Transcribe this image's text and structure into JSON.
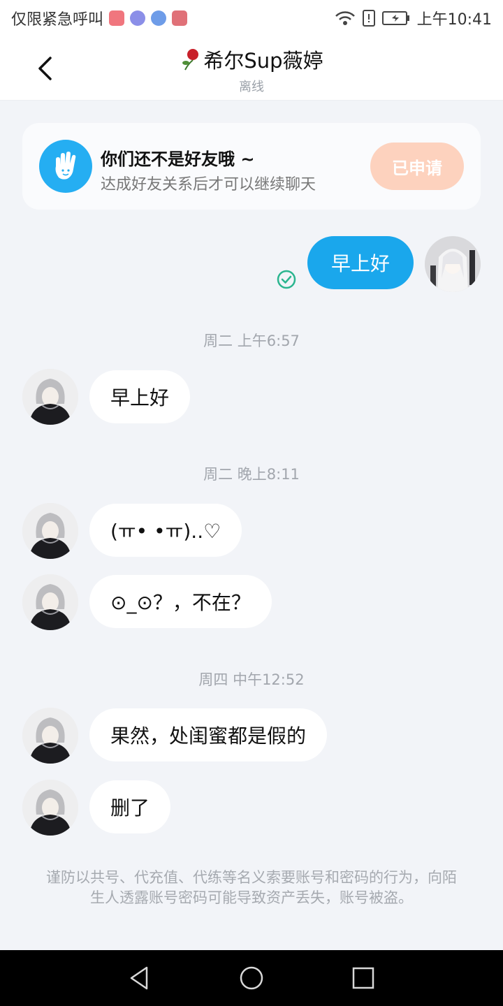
{
  "status_bar": {
    "carrier": "仅限紧急呼叫",
    "time": "上午10:41",
    "app_icon_colors": [
      "#f0767e",
      "#8b8fe8",
      "#6e9ce8",
      "#e07178"
    ]
  },
  "header": {
    "title": "希尔Sup薇婷",
    "status": "离线"
  },
  "friend_card": {
    "title": "你们还不是好友哦 ~",
    "subtitle": "达成好友关系后才可以继续聊天",
    "button": "已申请",
    "icon": "waving-hand-icon"
  },
  "messages": {
    "outgoing": {
      "text": "早上好",
      "read_icon": "check-circle-icon"
    },
    "groups": [
      {
        "time": "周二 上午6:57",
        "items": [
          "早上好"
        ]
      },
      {
        "time": "周二 晚上8:11",
        "items": [
          "(ㅠ• •ㅠ)..♡",
          "⊙_⊙？，不在？"
        ]
      },
      {
        "time": "周四 中午12:52",
        "items": [
          "果然，处闺蜜都是假的",
          "删了"
        ]
      }
    ]
  },
  "notice": "谨防以共号、代充值、代练等名义索要账号和密码的行为，向陌生人透露账号密码可能导致资产丢失，账号被盗。",
  "colors": {
    "accent": "#1aa7ec",
    "applied_button": "#fdd2be",
    "read_check": "#2bb58f"
  }
}
